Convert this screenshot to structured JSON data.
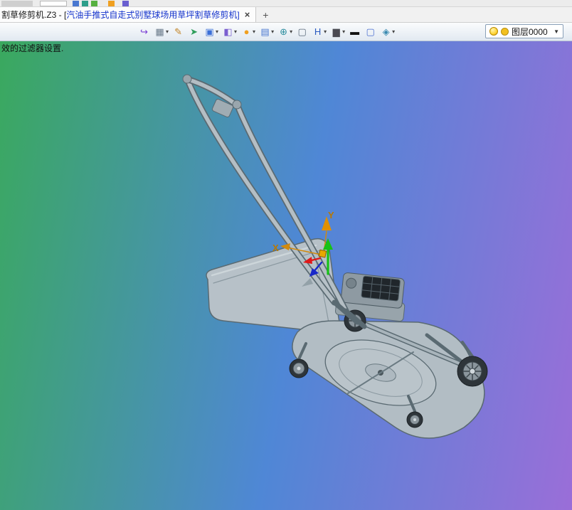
{
  "tab_bar": {
    "active_tab": {
      "title_black": "割草修剪机.Z3 - [",
      "title_blue": "汽油手推式自走式别墅球场用草坪割草修剪机]",
      "close": "×"
    },
    "new_tab_label": "+"
  },
  "toolbar": {
    "icons": [
      {
        "name": "exit-view-icon",
        "glyph": "↪",
        "color": "#7a3fd4",
        "caret": false
      },
      {
        "name": "view-manager-icon",
        "glyph": "▦",
        "color": "#6a7a8a",
        "caret": true
      },
      {
        "name": "pencil-icon",
        "glyph": "✎",
        "color": "#c08020",
        "caret": false
      },
      {
        "name": "fly-through-icon",
        "glyph": "➤",
        "color": "#2e9e5b",
        "caret": false
      },
      {
        "name": "shaded-cube-icon",
        "glyph": "▣",
        "color": "#3a6fd8",
        "caret": true
      },
      {
        "name": "render-mode-icon",
        "glyph": "◧",
        "color": "#7a5fd0",
        "caret": true
      },
      {
        "name": "color-wheel-icon",
        "glyph": "●",
        "color": "#f0a020",
        "caret": true
      },
      {
        "name": "image-capture-icon",
        "glyph": "▤",
        "color": "#4a78d0",
        "caret": true
      },
      {
        "name": "orient-compass-icon",
        "glyph": "⊕",
        "color": "#2e8ea0",
        "caret": true
      },
      {
        "name": "window-zoom-icon",
        "glyph": "▢",
        "color": "#5a6a7a",
        "caret": false
      },
      {
        "name": "text-height-icon",
        "glyph": "H",
        "color": "#2a5ac0",
        "caret": true
      },
      {
        "name": "display-mode-icon",
        "glyph": "▆",
        "color": "#4a4a52",
        "caret": true
      },
      {
        "name": "line-width-icon",
        "glyph": "▬",
        "color": "#111111",
        "caret": false
      },
      {
        "name": "background-icon",
        "glyph": "▢",
        "color": "#4a6fd0",
        "caret": false
      },
      {
        "name": "layers-icon",
        "glyph": "◈",
        "color": "#3a8ab0",
        "caret": true
      }
    ],
    "layer_combo_value": "图层0000",
    "combo_caret": "▼"
  },
  "prompt_text": "效的过滤器设置.",
  "viewport": {
    "axis_labels": {
      "x": "X",
      "y": "Y"
    },
    "colors": {
      "gradient_left": "#3aa95e",
      "gradient_mid": "#4f87d6",
      "gradient_right": "#9a6ed8",
      "model_fill": "#b7c1c8",
      "model_line": "#5a6a72"
    }
  }
}
